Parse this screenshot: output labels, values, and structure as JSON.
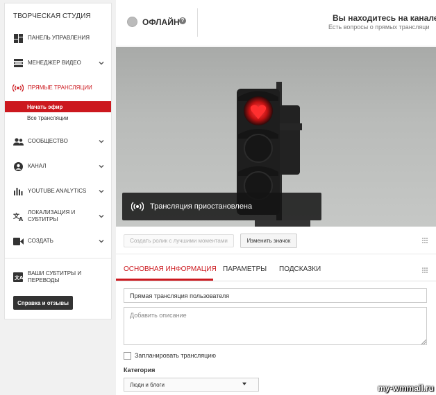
{
  "sidebar": {
    "title": "ТВОРЧЕСКАЯ СТУДИЯ",
    "items": [
      {
        "label": "ПАНЕЛЬ УПРАВЛЕНИЯ",
        "icon": "dashboard-icon"
      },
      {
        "label": "МЕНЕДЖЕР ВИДЕО",
        "icon": "video-manager-icon"
      },
      {
        "label": "ПРЯМЫЕ ТРАНСЛЯЦИИ",
        "icon": "live-broadcast-icon"
      },
      {
        "label": "СООБЩЕСТВО",
        "icon": "community-icon"
      },
      {
        "label": "КАНАЛ",
        "icon": "channel-icon"
      },
      {
        "label": "YOUTUBE ANALYTICS",
        "icon": "analytics-icon"
      },
      {
        "label": "ЛОКАЛИЗАЦИЯ И СУБТИТРЫ",
        "icon": "translate-icon"
      },
      {
        "label": "СОЗДАТЬ",
        "icon": "create-icon"
      }
    ],
    "live_subitems": [
      "Начать эфир",
      "Все трансляции"
    ],
    "subtitles_item": "ВАШИ СУБТИТРЫ И ПЕРЕВОДЫ",
    "help_button": "Справка и отзывы",
    "accent_color": "#cc181e"
  },
  "header": {
    "status": "ОФЛАЙН",
    "channel_text": "Вы находитесь на канале А",
    "channel_sub": "Есть вопросы о прямых трансляци"
  },
  "preview": {
    "paused_text": "Трансляция приостановлена"
  },
  "buttons": {
    "highlights": "Создать ролик с лучшими моментами",
    "change_thumb": "Изменить значок"
  },
  "tabs": [
    "ОСНОВНАЯ ИНФОРМАЦИЯ",
    "ПАРАМЕТРЫ",
    "ПОДСКАЗКИ"
  ],
  "form": {
    "title_value": "Прямая трансляция пользователя",
    "description_placeholder": "Добавить описание",
    "schedule_label": "Запланировать трансляцию",
    "category_label": "Категория",
    "category_value": "Люди и блоги"
  },
  "watermark": "my-wmmail.ru"
}
